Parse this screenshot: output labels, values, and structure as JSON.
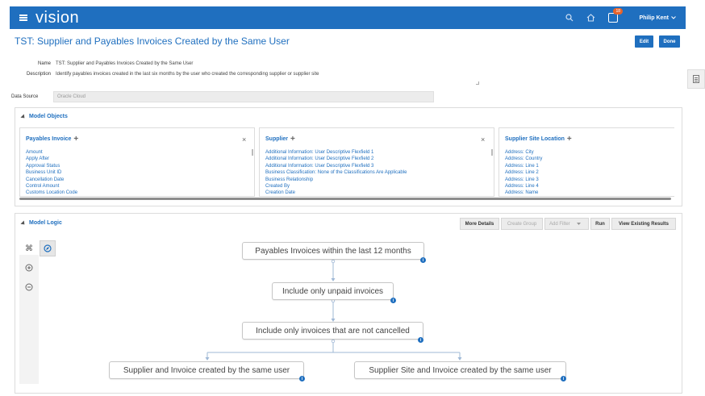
{
  "topbar": {
    "logo": "vision",
    "user_name": "Philip Kent",
    "notification_count": "18",
    "colors": {
      "bar": "#1f6fbf",
      "badge": "#e8632b"
    },
    "icons": [
      "hamburger-icon",
      "search-icon",
      "home-icon",
      "notification-icon",
      "chevron-down-icon"
    ]
  },
  "header": {
    "title": "TST: Supplier and Payables Invoices Created by the Same User",
    "edit_label": "Edit",
    "done_label": "Done"
  },
  "details": {
    "name_label": "Name",
    "name_value": "TST: Supplier and Payables Invoices Created by the Same User",
    "description_label": "Description",
    "description_value": "Identify payables invoices created in the last six months by the user who created the corresponding supplier or supplier site",
    "data_source_label": "Data Source",
    "data_source_value": "Oracle Cloud"
  },
  "model_objects": {
    "heading": "Model Objects",
    "cards": [
      {
        "title": "Payables Invoice",
        "fields": [
          "Amount",
          "Apply After",
          "Approval Status",
          "Business Unit ID",
          "Cancellation Date",
          "Control Amount",
          "Customs Location Code"
        ]
      },
      {
        "title": "Supplier",
        "fields": [
          "Additional Information: User Descriptive Flexfield 1",
          "Additional Information: User Descriptive Flexfield 2",
          "Additional Information: User Descriptive Flexfield 3",
          "Business Classification: None of the Classifications Are Applicable",
          "Business Relationship",
          "Created By",
          "Creation Date"
        ]
      },
      {
        "title": "Supplier Site Location",
        "fields": [
          "Address: City",
          "Address: Country",
          "Address: Line 1",
          "Address: Line 2",
          "Address: Line 3",
          "Address: Line 4",
          "Address: Name"
        ]
      }
    ]
  },
  "model_logic": {
    "heading": "Model Logic",
    "toolbar": {
      "more_details": "More Details",
      "create_group": "Create Group",
      "add_filter": "Add Filter",
      "run": "Run",
      "view_results": "View Existing Results"
    },
    "side_tools": [
      "hierarchy-icon",
      "compass-icon",
      "zoom-in-icon",
      "zoom-out-icon"
    ],
    "nodes": [
      "Payables Invoices within the last 12 months",
      "Include only unpaid invoices",
      "Include only invoices that are not cancelled",
      "Supplier and Invoice created by the same user",
      "Supplier Site and Invoice created by the same user"
    ],
    "info_glyph": "i"
  }
}
